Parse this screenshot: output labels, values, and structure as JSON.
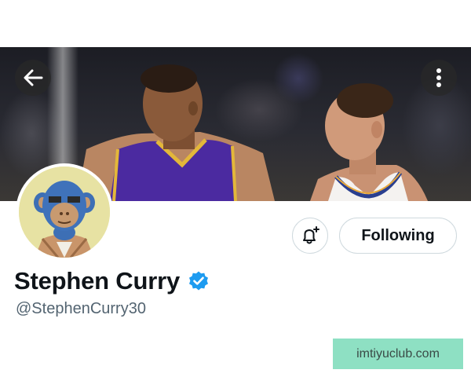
{
  "profile": {
    "display_name": "Stephen Curry",
    "handle": "@StephenCurry30",
    "verified": true
  },
  "actions": {
    "follow_label": "Following"
  },
  "icons": {
    "back": "arrow-left-icon",
    "more": "more-vertical-icon",
    "notify": "bell-plus-icon",
    "verified": "verified-badge-icon"
  },
  "colors": {
    "verified_blue": "#1d9bf0",
    "handle_gray": "#536471",
    "border": "#cfd9de"
  },
  "watermark": {
    "text": "imtiyuclub.com"
  }
}
